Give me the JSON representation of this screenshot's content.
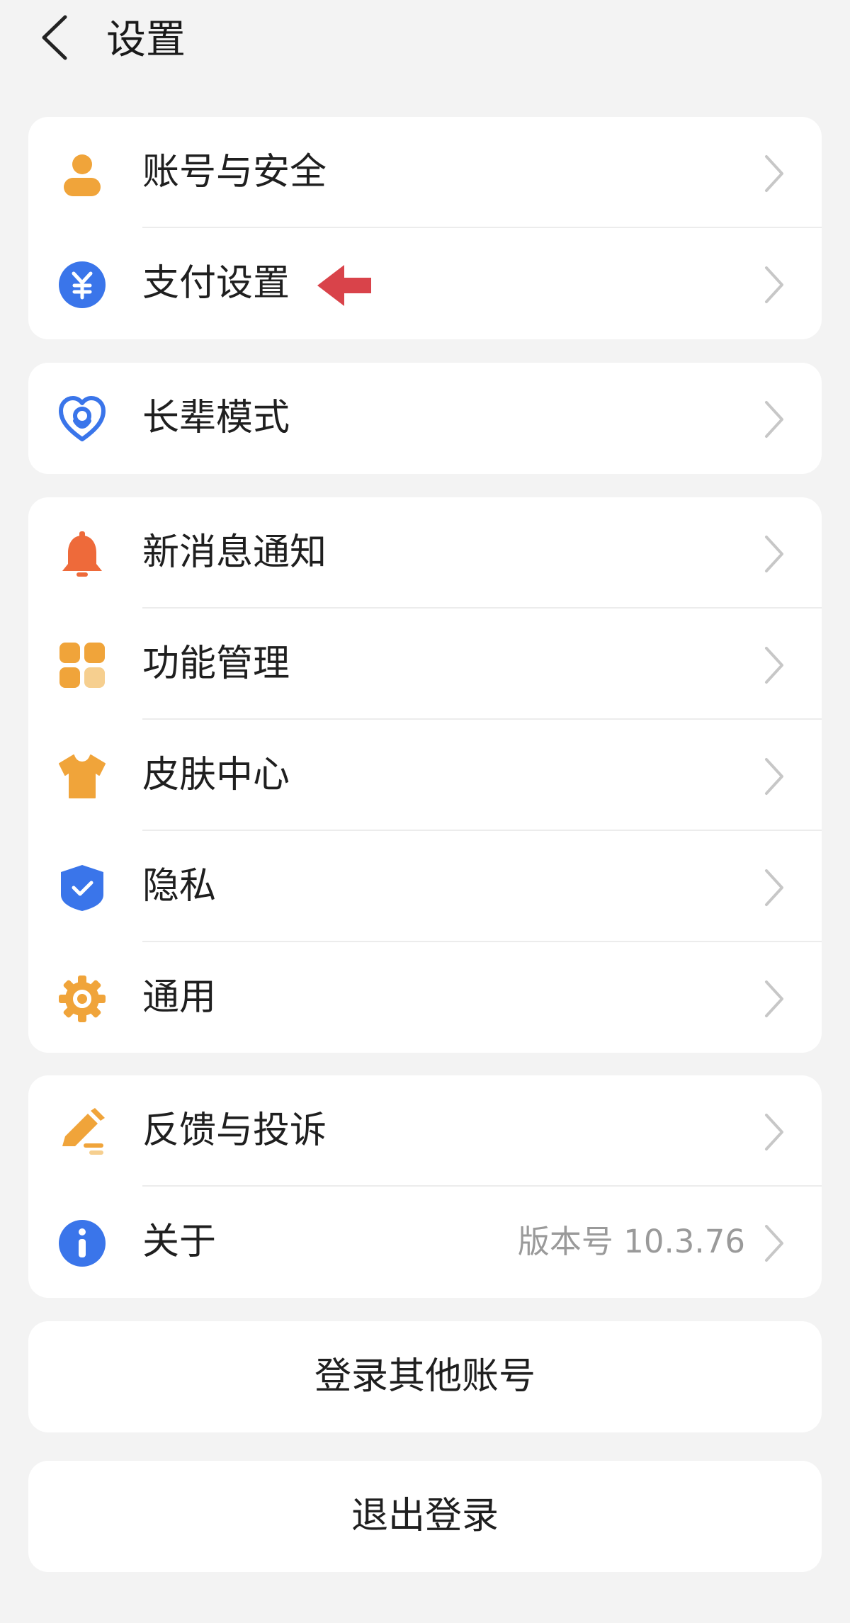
{
  "header": {
    "title": "设置"
  },
  "groups": [
    {
      "items": [
        {
          "label": "账号与安全",
          "icon": "person-icon"
        },
        {
          "label": "支付设置",
          "icon": "yuan-icon"
        }
      ]
    },
    {
      "items": [
        {
          "label": "长辈模式",
          "icon": "heart-icon"
        }
      ]
    },
    {
      "items": [
        {
          "label": "新消息通知",
          "icon": "bell-icon"
        },
        {
          "label": "功能管理",
          "icon": "grid-icon"
        },
        {
          "label": "皮肤中心",
          "icon": "shirt-icon"
        },
        {
          "label": "隐私",
          "icon": "shield-icon"
        },
        {
          "label": "通用",
          "icon": "gear-icon"
        }
      ]
    },
    {
      "items": [
        {
          "label": "反馈与投诉",
          "icon": "pencil-icon"
        },
        {
          "label": "关于",
          "icon": "info-icon",
          "value": "版本号 10.3.76"
        }
      ]
    }
  ],
  "buttons": {
    "switch_account": "登录其他账号",
    "logout": "退出登录"
  },
  "colors": {
    "orange": "#f0a43a",
    "blue": "#3a75ea",
    "red_orange": "#ee6a3a",
    "annotation_red": "#d9434a"
  }
}
